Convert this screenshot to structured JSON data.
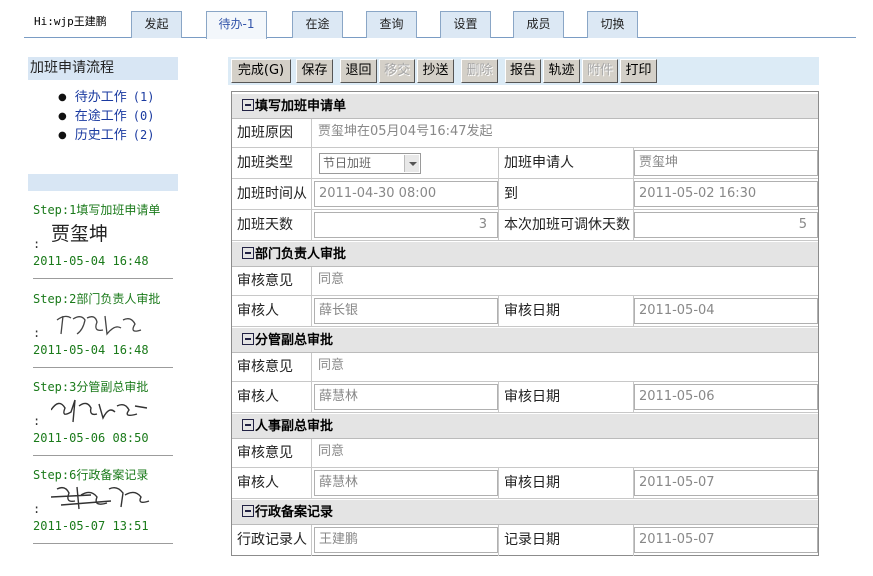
{
  "header": {
    "greeting": "Hi:wjp王建鹏",
    "tabs": [
      "发起",
      "待办-1",
      "在途",
      "查询",
      "设置",
      "成员",
      "切换"
    ]
  },
  "sidebar": {
    "title": "加班申请流程",
    "items": [
      {
        "label": "待办工作",
        "count": "(1)"
      },
      {
        "label": "在途工作",
        "count": "(0)"
      },
      {
        "label": "历史工作",
        "count": "(2)"
      }
    ],
    "steps": [
      {
        "title": "Step:1填写加班申请单",
        "signer": "贾玺坤",
        "time": "2011-05-04 16:48"
      },
      {
        "title": "Step:2部门负责人审批",
        "signer": "薛长银",
        "time": "2011-05-04 16:48"
      },
      {
        "title": "Step:3分管副总审批",
        "signer": "薛慧林",
        "time": "2011-05-06 08:50"
      },
      {
        "title": "Step:6行政备案记录",
        "signer": "王建鹏",
        "time": "2011-05-07 13:51"
      }
    ],
    "colon": ":"
  },
  "toolbar": {
    "complete": "完成(G)",
    "save": "保存",
    "back": "退回",
    "transfer": "移交",
    "cc": "抄送",
    "delete": "删除",
    "report": "报告",
    "track": "轨迹",
    "attach": "附件",
    "print": "打印"
  },
  "form": {
    "sec1": "填写加班申请单",
    "reason_label": "加班原因",
    "reason": "贾玺坤在05月04号16:47发起",
    "type_label": "加班类型",
    "type": "节日加班",
    "applicant_label": "加班申请人",
    "applicant": "贾玺坤",
    "from_label": "加班时间从",
    "from": "2011-04-30 08:00",
    "to_label": "到",
    "to": "2011-05-02 16:30",
    "days_label": "加班天数",
    "days": "3",
    "rest_label": "本次加班可调休天数",
    "rest": "5",
    "sec2": "部门负责人审批",
    "op_label": "审核意见",
    "op2": "同意",
    "rev_label": "审核人",
    "rev2": "薛长银",
    "date_label": "审核日期",
    "date2": "2011-05-04",
    "sec3": "分管副总审批",
    "op3": "同意",
    "rev3": "薛慧林",
    "date3": "2011-05-06",
    "sec4": "人事副总审批",
    "op4": "同意",
    "rev4": "薛慧林",
    "date4": "2011-05-07",
    "sec5": "行政备案记录",
    "rec_label": "行政记录人",
    "rec": "王建鹏",
    "recdate_label": "记录日期",
    "recdate": "2011-05-07"
  }
}
